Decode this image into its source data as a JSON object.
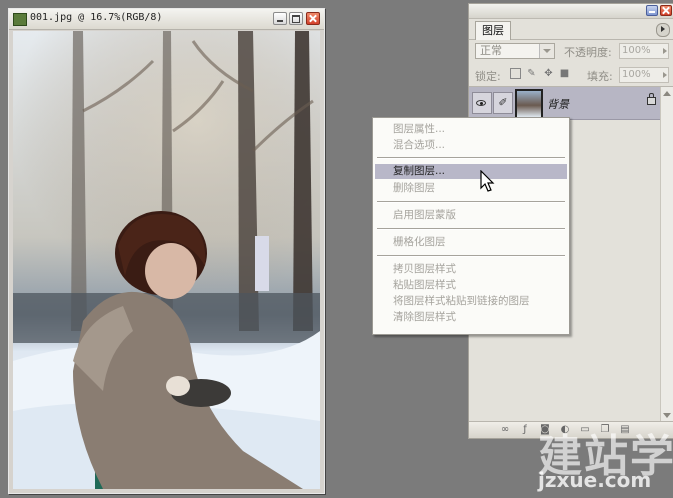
{
  "document": {
    "title": "001.jpg @ 16.7%(RGB/8)"
  },
  "layers_panel": {
    "tab_label": "图层",
    "blend_mode": "正常",
    "opacity_label": "不透明度:",
    "opacity_value": "100%",
    "lock_label": "锁定:",
    "fill_label": "填充:",
    "fill_value": "100%",
    "layers": [
      {
        "name": "背景",
        "visible": true,
        "locked": true
      }
    ]
  },
  "context_menu": {
    "items": [
      {
        "label": "图层属性...",
        "enabled": false
      },
      {
        "label": "混合选项...",
        "enabled": false
      },
      {
        "label": "复制图层...",
        "enabled": true,
        "highlighted": true
      },
      {
        "label": "删除图层",
        "enabled": false
      },
      {
        "label": "启用图层蒙版",
        "enabled": false
      },
      {
        "label": "栅格化图层",
        "enabled": false
      },
      {
        "label": "拷贝图层样式",
        "enabled": false
      },
      {
        "label": "粘贴图层样式",
        "enabled": false
      },
      {
        "label": "将图层样式粘贴到链接的图层",
        "enabled": false
      },
      {
        "label": "清除图层样式",
        "enabled": false
      }
    ]
  },
  "watermark": {
    "logo": "建站学",
    "url": "jzxue.com"
  }
}
